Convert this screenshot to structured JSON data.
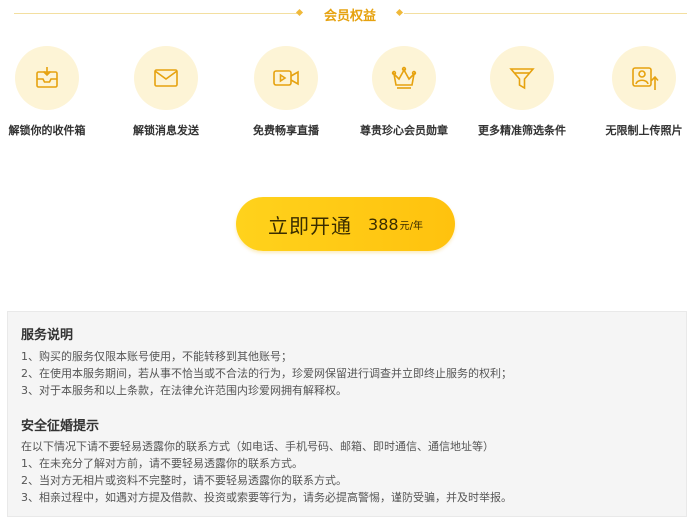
{
  "header": {
    "title": "会员权益"
  },
  "benefits": [
    {
      "icon": "inbox-icon",
      "label": "解锁你的收件箱"
    },
    {
      "icon": "envelope-icon",
      "label": "解锁消息发送"
    },
    {
      "icon": "video-icon",
      "label": "免费畅享直播"
    },
    {
      "icon": "crown-icon",
      "label": "尊贵珍心会员勋章"
    },
    {
      "icon": "filter-icon",
      "label": "更多精准筛选条件"
    },
    {
      "icon": "photo-upload-icon",
      "label": "无限制上传照片"
    }
  ],
  "cta": {
    "label": "立即开通",
    "price": "388",
    "unit": "元/年"
  },
  "service": {
    "title": "服务说明",
    "lines": [
      "1、购买的服务仅限本账号使用，不能转移到其他账号；",
      "2、在使用本服务期间，若从事不恰当或不合法的行为，珍爱网保留进行调查并立即终止服务的权利；",
      "3、对于本服务和以上条款，在法律允许范围内珍爱网拥有解释权。"
    ]
  },
  "safety": {
    "title": "安全征婚提示",
    "lines": [
      "在以下情况下请不要轻易透露你的联系方式（如电话、手机号码、邮箱、即时通信、通信地址等）",
      "1、在未充分了解对方前，请不要轻易透露你的联系方式。",
      "2、当对方无相片或资料不完整时，请不要轻易透露你的联系方式。",
      "3、相亲过程中，如遇对方提及借款、投资或索要等行为，请务必提高警惕，谨防受骗，并及时举报。"
    ]
  },
  "colors": {
    "accent": "#e6a20f",
    "icon_bg": "#fdf4d6",
    "button": "#ffd21c"
  }
}
